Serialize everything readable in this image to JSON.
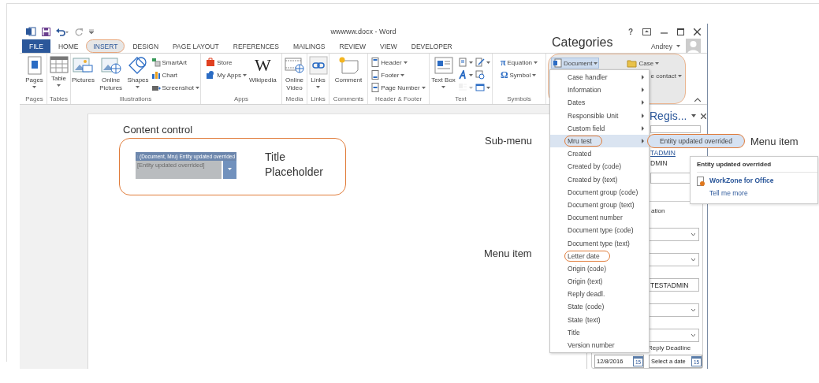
{
  "window": {
    "title": "wwwww.docx - Word",
    "help": "?",
    "user": "Andrey"
  },
  "tabs": [
    {
      "label": "FILE",
      "kind": "file",
      "selected": false,
      "circled": false
    },
    {
      "label": "HOME",
      "kind": "tab",
      "selected": false,
      "circled": false
    },
    {
      "label": "INSERT",
      "kind": "tab",
      "selected": true,
      "circled": true
    },
    {
      "label": "DESIGN",
      "kind": "tab",
      "selected": false,
      "circled": false
    },
    {
      "label": "PAGE LAYOUT",
      "kind": "tab",
      "selected": false,
      "circled": false
    },
    {
      "label": "REFERENCES",
      "kind": "tab",
      "selected": false,
      "circled": false
    },
    {
      "label": "MAILINGS",
      "kind": "tab",
      "selected": false,
      "circled": false
    },
    {
      "label": "REVIEW",
      "kind": "tab",
      "selected": false,
      "circled": false
    },
    {
      "label": "VIEW",
      "kind": "tab",
      "selected": false,
      "circled": false
    },
    {
      "label": "DEVELOPER",
      "kind": "tab",
      "selected": false,
      "circled": false
    }
  ],
  "ribbon_groups": [
    {
      "label": "Pages",
      "circled": false,
      "items": [
        {
          "label": "Pages",
          "kind": "large",
          "dropdown": true
        }
      ]
    },
    {
      "label": "Tables",
      "circled": false,
      "items": [
        {
          "label": "Table",
          "kind": "large",
          "dropdown": true
        }
      ]
    },
    {
      "label": "Illustrations",
      "circled": false,
      "items": [
        {
          "label": "Pictures",
          "kind": "large",
          "dropdown": false
        },
        {
          "label": "Online Pictures",
          "kind": "large",
          "dropdown": false
        },
        {
          "label": "Shapes",
          "kind": "large",
          "dropdown": true
        },
        {
          "label": "SmartArt",
          "kind": "small",
          "dropdown": false
        },
        {
          "label": "Chart",
          "kind": "small",
          "dropdown": false
        },
        {
          "label": "Screenshot",
          "kind": "small",
          "dropdown": true
        }
      ]
    },
    {
      "label": "Apps",
      "circled": false,
      "items": [
        {
          "label": "Store",
          "kind": "small",
          "dropdown": false
        },
        {
          "label": "My Apps",
          "kind": "small",
          "dropdown": true
        },
        {
          "label": "Wikipedia",
          "kind": "large",
          "dropdown": false,
          "glyph": "W"
        }
      ]
    },
    {
      "label": "Media",
      "circled": false,
      "items": [
        {
          "label": "Online Video",
          "kind": "large",
          "dropdown": false
        }
      ]
    },
    {
      "label": "Links",
      "circled": false,
      "items": [
        {
          "label": "Links",
          "kind": "large",
          "dropdown": true
        }
      ]
    },
    {
      "label": "Comments",
      "circled": false,
      "items": [
        {
          "label": "Comment",
          "kind": "large",
          "dropdown": false
        }
      ]
    },
    {
      "label": "Header & Footer",
      "circled": false,
      "items": [
        {
          "label": "Header",
          "kind": "small",
          "dropdown": true
        },
        {
          "label": "Footer",
          "kind": "small",
          "dropdown": true
        },
        {
          "label": "Page Number",
          "kind": "small",
          "dropdown": true
        }
      ]
    },
    {
      "label": "Text",
      "circled": false,
      "items": [
        {
          "label": "Text Box",
          "kind": "large",
          "dropdown": true,
          "disabled": false
        },
        {
          "kind": "small",
          "dropdown": true,
          "disabled": false
        },
        {
          "kind": "small",
          "dropdown": true,
          "disabled": false
        },
        {
          "kind": "small",
          "dropdown": true,
          "disabled": true
        },
        {
          "kind": "small",
          "dropdown": true,
          "disabled": false
        },
        {
          "kind": "small",
          "dropdown": false,
          "disabled": false
        },
        {
          "kind": "small",
          "dropdown": true,
          "disabled": false
        }
      ]
    },
    {
      "label": "Symbols",
      "circled": false,
      "items": [
        {
          "label": "Equation",
          "kind": "small",
          "dropdown": true,
          "glyph": "π"
        },
        {
          "label": "Symbol",
          "kind": "small",
          "dropdown": true,
          "glyph": "Ω"
        }
      ]
    },
    {
      "circled": true,
      "items": [
        {
          "label": "Document",
          "kind": "small",
          "dropdown": true,
          "open": true
        },
        {
          "label": "Case",
          "kind": "small",
          "dropdown": true,
          "open": false
        },
        {
          "label": "e contact",
          "kind": "small",
          "dropdown": true,
          "open": false
        }
      ]
    }
  ],
  "annotations": [
    {
      "text": "Categories"
    },
    {
      "text": "Content control"
    },
    {
      "text": "Title Placeholder"
    },
    {
      "text": "Sub-menu"
    },
    {
      "text": "Menu item"
    },
    {
      "text": "Menu item"
    }
  ],
  "content_control": {
    "tag": "(Document, Mru) Entity updated overrided",
    "placeholder": "[Entity updated overrided]"
  },
  "task_pane": {
    "title": "Regis...",
    "rows": [
      {
        "kind": "field"
      },
      {
        "kind": "link",
        "text": "TADMIN"
      },
      {
        "kind": "text",
        "text": "DMIN"
      },
      {
        "kind": "field"
      }
    ],
    "group": {
      "label": "ation",
      "rows": [
        {
          "kind": "dropdown"
        },
        {
          "kind": "dropdown"
        },
        {
          "kind": "field",
          "text": "TESTADMIN"
        },
        {
          "kind": "dropdown"
        },
        {
          "kind": "dropdown"
        },
        {
          "kind": "label",
          "text": "Reply Deadline"
        }
      ],
      "dates": [
        {
          "value": "12/8/2016",
          "day": "15"
        },
        {
          "placeholder": "Select a date",
          "day": "15"
        }
      ]
    }
  },
  "document_menu": {
    "items": [
      {
        "label": "Case handler",
        "submenu": true,
        "selected": false,
        "circled": false
      },
      {
        "label": "Information",
        "submenu": true,
        "selected": false,
        "circled": false
      },
      {
        "label": "Dates",
        "submenu": true,
        "selected": false,
        "circled": false
      },
      {
        "label": "Responsible Unit",
        "submenu": true,
        "selected": false,
        "circled": false
      },
      {
        "label": "Custom field",
        "submenu": true,
        "selected": false,
        "circled": false
      },
      {
        "label": "Mru test",
        "submenu": true,
        "selected": true,
        "circled": true
      },
      {
        "label": "Created",
        "submenu": false,
        "selected": false,
        "circled": false
      },
      {
        "label": "Created by (code)",
        "submenu": false,
        "selected": false,
        "circled": false
      },
      {
        "label": "Created by (text)",
        "submenu": false,
        "selected": false,
        "circled": false
      },
      {
        "label": "Document group (code)",
        "submenu": false,
        "selected": false,
        "circled": false
      },
      {
        "label": "Document group (text)",
        "submenu": false,
        "selected": false,
        "circled": false
      },
      {
        "label": "Document number",
        "submenu": false,
        "selected": false,
        "circled": false
      },
      {
        "label": "Document type (code)",
        "submenu": false,
        "selected": false,
        "circled": false
      },
      {
        "label": "Document type (text)",
        "submenu": false,
        "selected": false,
        "circled": false
      },
      {
        "label": "Letter date",
        "submenu": false,
        "selected": false,
        "circled": true
      },
      {
        "label": "Origin (code)",
        "submenu": false,
        "selected": false,
        "circled": false
      },
      {
        "label": "Origin (text)",
        "submenu": false,
        "selected": false,
        "circled": false
      },
      {
        "label": "Reply deadl.",
        "submenu": false,
        "selected": false,
        "circled": false
      },
      {
        "label": "State (code)",
        "submenu": false,
        "selected": false,
        "circled": false
      },
      {
        "label": "State (text)",
        "submenu": false,
        "selected": false,
        "circled": false
      },
      {
        "label": "Title",
        "submenu": false,
        "selected": false,
        "circled": false
      },
      {
        "label": "Version number",
        "submenu": false,
        "selected": false,
        "circled": false
      }
    ]
  },
  "submenu": {
    "items": [
      {
        "label": "Entity updated overrided",
        "selected": true,
        "circled": true
      }
    ]
  },
  "tooltip": {
    "title": "Entity updated overrided",
    "product": "WorkZone for Office",
    "link": "Tell me more"
  }
}
